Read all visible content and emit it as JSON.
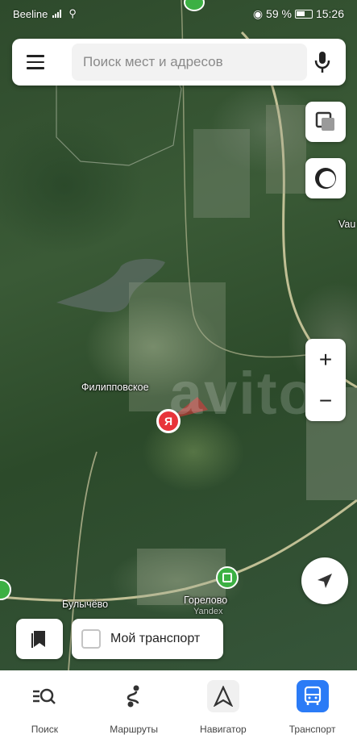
{
  "status_bar": {
    "carrier": "Beeline",
    "battery": "59 %",
    "time": "15:26"
  },
  "search": {
    "placeholder": "Поиск мест и адресов"
  },
  "map": {
    "places": {
      "filippovskoe": "Филипповское",
      "bulychevo": "Булычёво",
      "gorelovo": "Горелово",
      "vau": "Vau"
    },
    "watermark": "avito",
    "attribution": "Yandex",
    "marker_letter": "Я"
  },
  "controls": {
    "zoom_in": "+",
    "zoom_out": "−"
  },
  "transport_chip": {
    "label": "Мой транспорт"
  },
  "tabs": [
    {
      "label": "Поиск",
      "icon": "search-list-icon",
      "active": false
    },
    {
      "label": "Маршруты",
      "icon": "routes-icon",
      "active": false
    },
    {
      "label": "Навигатор",
      "icon": "navigator-icon",
      "active": false
    },
    {
      "label": "Транспорт",
      "icon": "bus-icon",
      "active": true
    }
  ],
  "colors": {
    "accent": "#2b7bf6",
    "marker_red": "#e8343a",
    "transit_green": "#3cb043"
  }
}
